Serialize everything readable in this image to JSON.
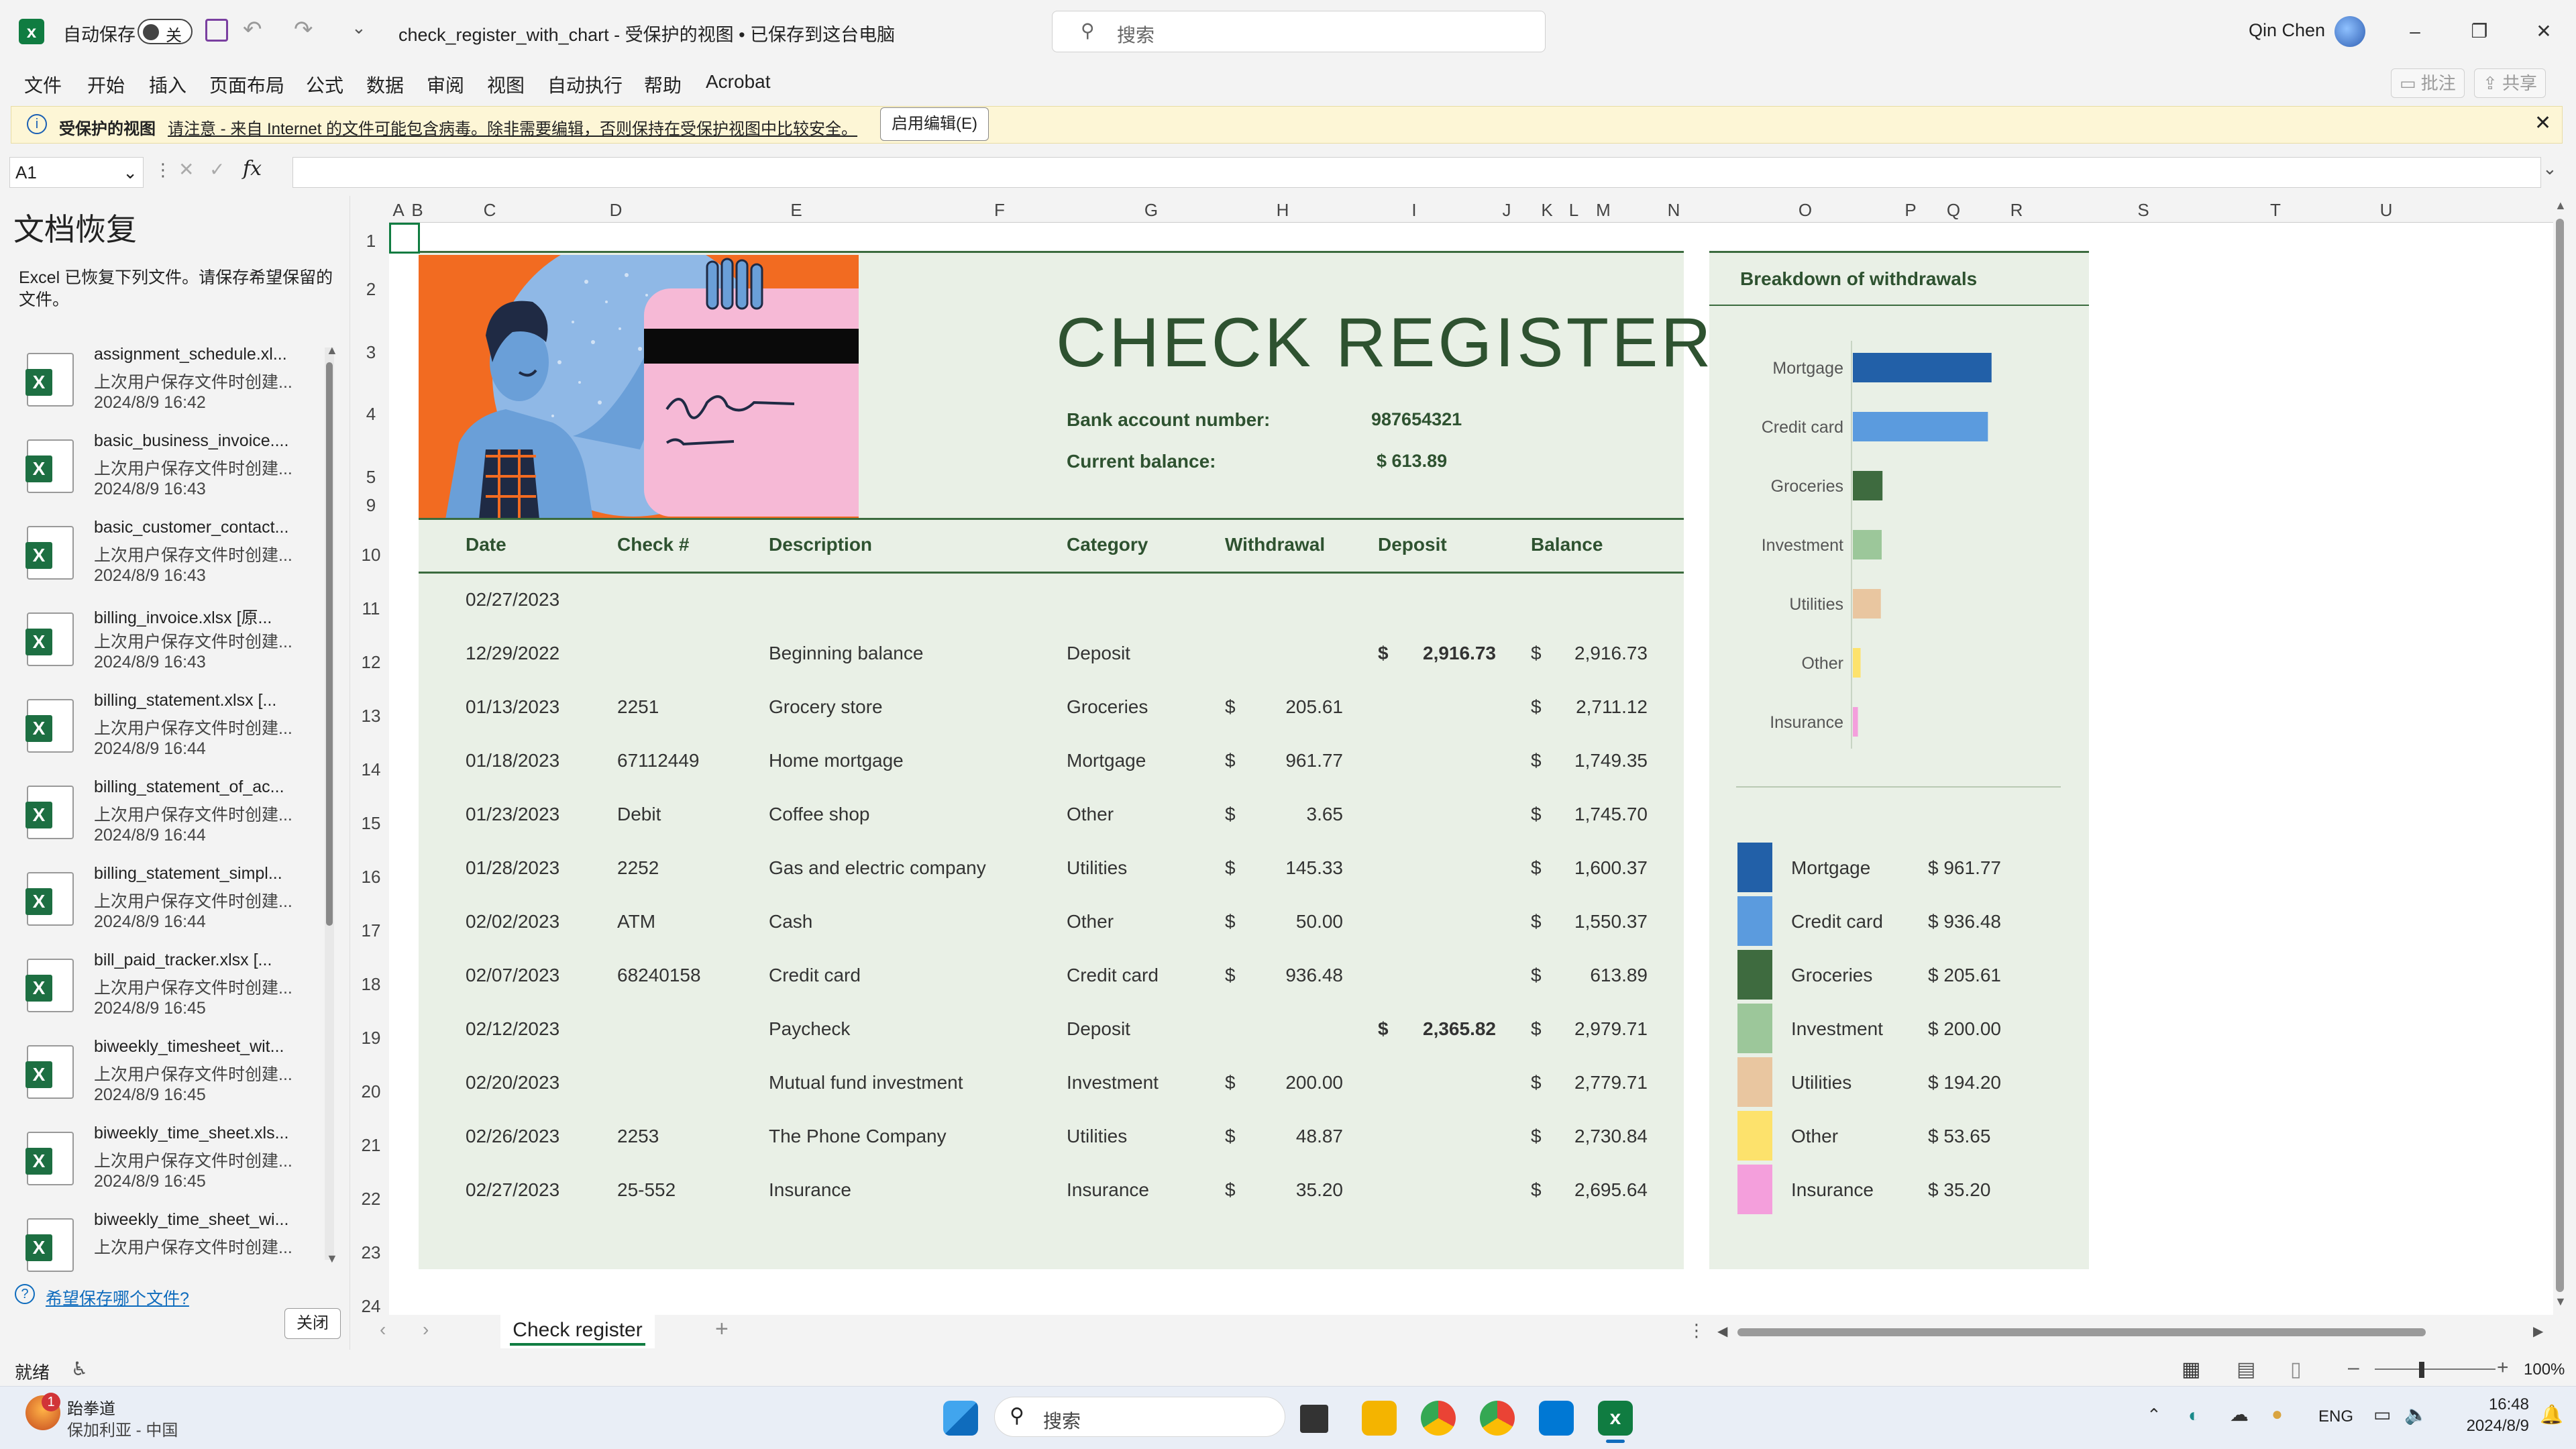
{
  "titlebar": {
    "autosave_label": "自动保存",
    "autosave_state": "关",
    "document_title": "check_register_with_chart - 受保护的视图 • 已保存到这台电脑",
    "search_placeholder": "搜索",
    "user_name": "Qin Chen"
  },
  "ribbon": {
    "menu": [
      "文件",
      "开始",
      "插入",
      "页面布局",
      "公式",
      "数据",
      "审阅",
      "视图",
      "自动执行",
      "帮助",
      "Acrobat"
    ],
    "comment_btn": "批注",
    "share_btn": "共享"
  },
  "protected_bar": {
    "title": "受保护的视图",
    "message": "请注意 - 来自 Internet 的文件可能包含病毒。除非需要编辑，否则保持在受保护视图中比较安全。",
    "enable_button": "启用编辑(E)"
  },
  "formula_bar": {
    "name_box": "A1",
    "fx": "fx",
    "content": ""
  },
  "recovery": {
    "title": "文档恢复",
    "description": "Excel 已恢复下列文件。请保存希望保留的文件。",
    "files": [
      {
        "name": "assignment_schedule.xl...",
        "sub": "上次用户保存文件时创建...",
        "date": "2024/8/9 16:42"
      },
      {
        "name": "basic_business_invoice....",
        "sub": "上次用户保存文件时创建...",
        "date": "2024/8/9 16:43"
      },
      {
        "name": "basic_customer_contact...",
        "sub": "上次用户保存文件时创建...",
        "date": "2024/8/9 16:43"
      },
      {
        "name": "billing_invoice.xlsx  [原...",
        "sub": "上次用户保存文件时创建...",
        "date": "2024/8/9 16:43"
      },
      {
        "name": "billing_statement.xlsx  [...",
        "sub": "上次用户保存文件时创建...",
        "date": "2024/8/9 16:44"
      },
      {
        "name": "billing_statement_of_ac...",
        "sub": "上次用户保存文件时创建...",
        "date": "2024/8/9 16:44"
      },
      {
        "name": "billing_statement_simpl...",
        "sub": "上次用户保存文件时创建...",
        "date": "2024/8/9 16:44"
      },
      {
        "name": "bill_paid_tracker.xlsx  [...",
        "sub": "上次用户保存文件时创建...",
        "date": "2024/8/9 16:45"
      },
      {
        "name": "biweekly_timesheet_wit...",
        "sub": "上次用户保存文件时创建...",
        "date": "2024/8/9 16:45"
      },
      {
        "name": "biweekly_time_sheet.xls...",
        "sub": "上次用户保存文件时创建...",
        "date": "2024/8/9 16:45"
      },
      {
        "name": "biweekly_time_sheet_wi...",
        "sub": "上次用户保存文件时创建...",
        "date": ""
      }
    ],
    "which_file_link": "希望保存哪个文件?",
    "close_button": "关闭"
  },
  "grid": {
    "columns": [
      "A",
      "B",
      "C",
      "D",
      "E",
      "F",
      "G",
      "H",
      "I",
      "J",
      "K",
      "L",
      "M",
      "N",
      "O",
      "P",
      "Q",
      "R",
      "S",
      "T",
      "U"
    ],
    "rows": [
      "1",
      "2",
      "3",
      "4",
      "5",
      "9",
      "10",
      "11",
      "12",
      "13",
      "14",
      "15",
      "16",
      "17",
      "18",
      "19",
      "20",
      "21",
      "22",
      "23",
      "24"
    ]
  },
  "register": {
    "title": "CHECK REGISTER",
    "account_label": "Bank account number:",
    "account_value": "987654321",
    "balance_label": "Current balance:",
    "balance_value": "$ 613.89",
    "headers": [
      "Date",
      "Check #",
      "Description",
      "Category",
      "Withdrawal",
      "Deposit",
      "Balance"
    ],
    "first_date": "02/27/2023",
    "currency_symbol": "$",
    "rows": [
      {
        "date": "12/29/2022",
        "check": "",
        "desc": "Beginning balance",
        "cat": "Deposit",
        "withdrawal": "",
        "deposit": "2,916.73",
        "balance": "2,916.73"
      },
      {
        "date": "01/13/2023",
        "check": "2251",
        "desc": "Grocery store",
        "cat": "Groceries",
        "withdrawal": "205.61",
        "deposit": "",
        "balance": "2,711.12"
      },
      {
        "date": "01/18/2023",
        "check": "67112449",
        "desc": "Home mortgage",
        "cat": "Mortgage",
        "withdrawal": "961.77",
        "deposit": "",
        "balance": "1,749.35"
      },
      {
        "date": "01/23/2023",
        "check": "Debit",
        "desc": "Coffee shop",
        "cat": "Other",
        "withdrawal": "3.65",
        "deposit": "",
        "balance": "1,745.70"
      },
      {
        "date": "01/28/2023",
        "check": "2252",
        "desc": "Gas and electric company",
        "cat": "Utilities",
        "withdrawal": "145.33",
        "deposit": "",
        "balance": "1,600.37"
      },
      {
        "date": "02/02/2023",
        "check": "ATM",
        "desc": "Cash",
        "cat": "Other",
        "withdrawal": "50.00",
        "deposit": "",
        "balance": "1,550.37"
      },
      {
        "date": "02/07/2023",
        "check": "68240158",
        "desc": "Credit card",
        "cat": "Credit card",
        "withdrawal": "936.48",
        "deposit": "",
        "balance": "613.89"
      },
      {
        "date": "02/12/2023",
        "check": "",
        "desc": "Paycheck",
        "cat": "Deposit",
        "withdrawal": "",
        "deposit": "2,365.82",
        "balance": "2,979.71"
      },
      {
        "date": "02/20/2023",
        "check": "",
        "desc": "Mutual fund investment",
        "cat": "Investment",
        "withdrawal": "200.00",
        "deposit": "",
        "balance": "2,779.71"
      },
      {
        "date": "02/26/2023",
        "check": "2253",
        "desc": "The Phone Company",
        "cat": "Utilities",
        "withdrawal": "48.87",
        "deposit": "",
        "balance": "2,730.84"
      },
      {
        "date": "02/27/2023",
        "check": "25-552",
        "desc": "Insurance",
        "cat": "Insurance",
        "withdrawal": "35.20",
        "deposit": "",
        "balance": "2,695.64"
      }
    ]
  },
  "chart_data": {
    "type": "bar",
    "orientation": "horizontal",
    "title": "Breakdown of withdrawals",
    "categories": [
      "Mortgage",
      "Credit card",
      "Groceries",
      "Investment",
      "Utilities",
      "Other",
      "Insurance"
    ],
    "values": [
      961.77,
      936.48,
      205.61,
      200.0,
      194.2,
      53.65,
      35.2
    ],
    "colors": [
      "#2260a8",
      "#5b9bde",
      "#3e6b3f",
      "#9cc79a",
      "#e9c6a0",
      "#fde26c",
      "#f49fdc"
    ],
    "legend_labels": [
      "$ 961.77",
      "$ 936.48",
      "$ 205.61",
      "$ 200.00",
      "$ 194.20",
      "$ 53.65",
      "$ 35.20"
    ],
    "xlim": [
      0,
      4000
    ],
    "grid": false,
    "legend": "bottom"
  },
  "sheet_tabs": {
    "active": "Check register"
  },
  "statusbar": {
    "ready": "就绪",
    "zoom": "100%"
  },
  "taskbar": {
    "weather_title": "跆拳道",
    "weather_sub": "保加利亚 - 中国",
    "search_placeholder": "搜索",
    "lang": "ENG",
    "time": "16:48",
    "date": "2024/8/9",
    "weather_badge": "1"
  }
}
